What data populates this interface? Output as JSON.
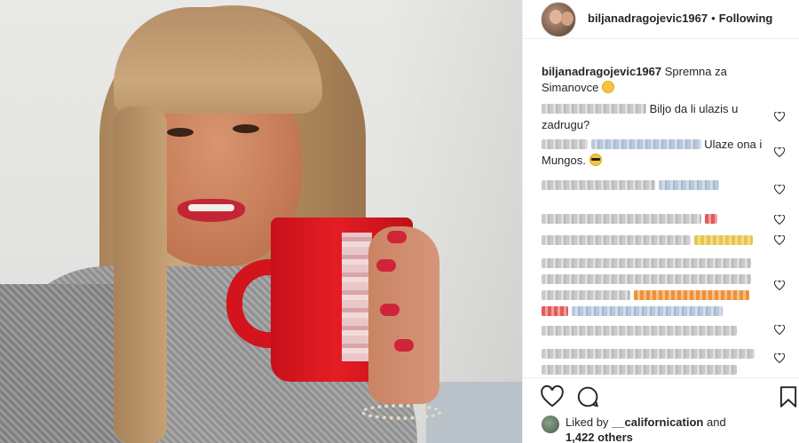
{
  "header": {
    "username": "biljanadragojevic1967",
    "separator": "•",
    "follow_status": "Following"
  },
  "caption": {
    "username": "biljanadragojevic1967",
    "text": "Spremna za Simanovce"
  },
  "comments": [
    {
      "text": "Biljo da li ulazis u zadrugu?"
    },
    {
      "text": "Ulaze ona i Mungos."
    }
  ],
  "likes": {
    "prefix": "Liked by",
    "user": "__californication",
    "connector": "and",
    "count": "1,422 others"
  },
  "icons": {
    "heart": "heart-icon",
    "comment": "comment-icon",
    "bookmark": "bookmark-icon"
  },
  "colors": {
    "text": "#262626",
    "divider": "#efefef",
    "mug_red": "#e51d25"
  }
}
